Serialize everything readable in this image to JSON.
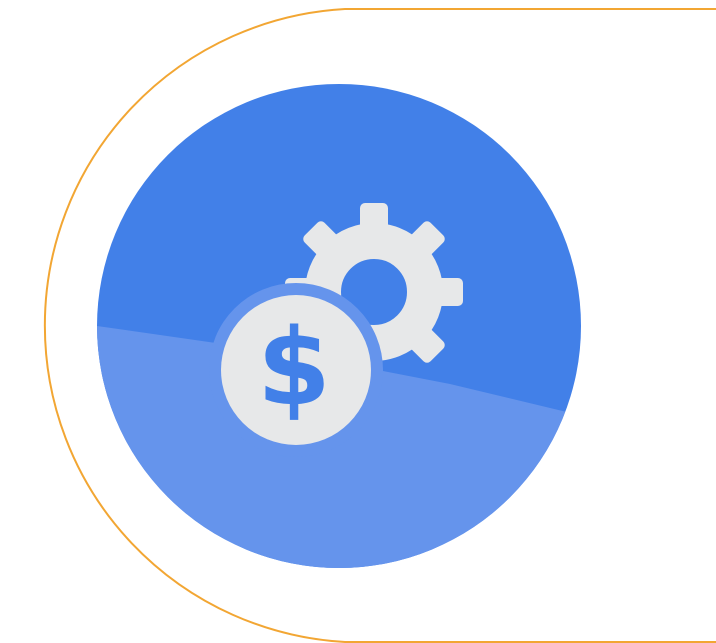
{
  "colors": {
    "background": "#ffffff",
    "outline": "#f2a633",
    "circle_primary": "#4280e8",
    "circle_secondary": "#6594ec",
    "icon_fill": "#e7e8e9"
  },
  "icons": {
    "badge": "settings-cost-icon",
    "gear": "gear-icon",
    "coin": "dollar-coin-icon"
  },
  "icon_glyphs": {
    "currency_symbol": "$"
  }
}
